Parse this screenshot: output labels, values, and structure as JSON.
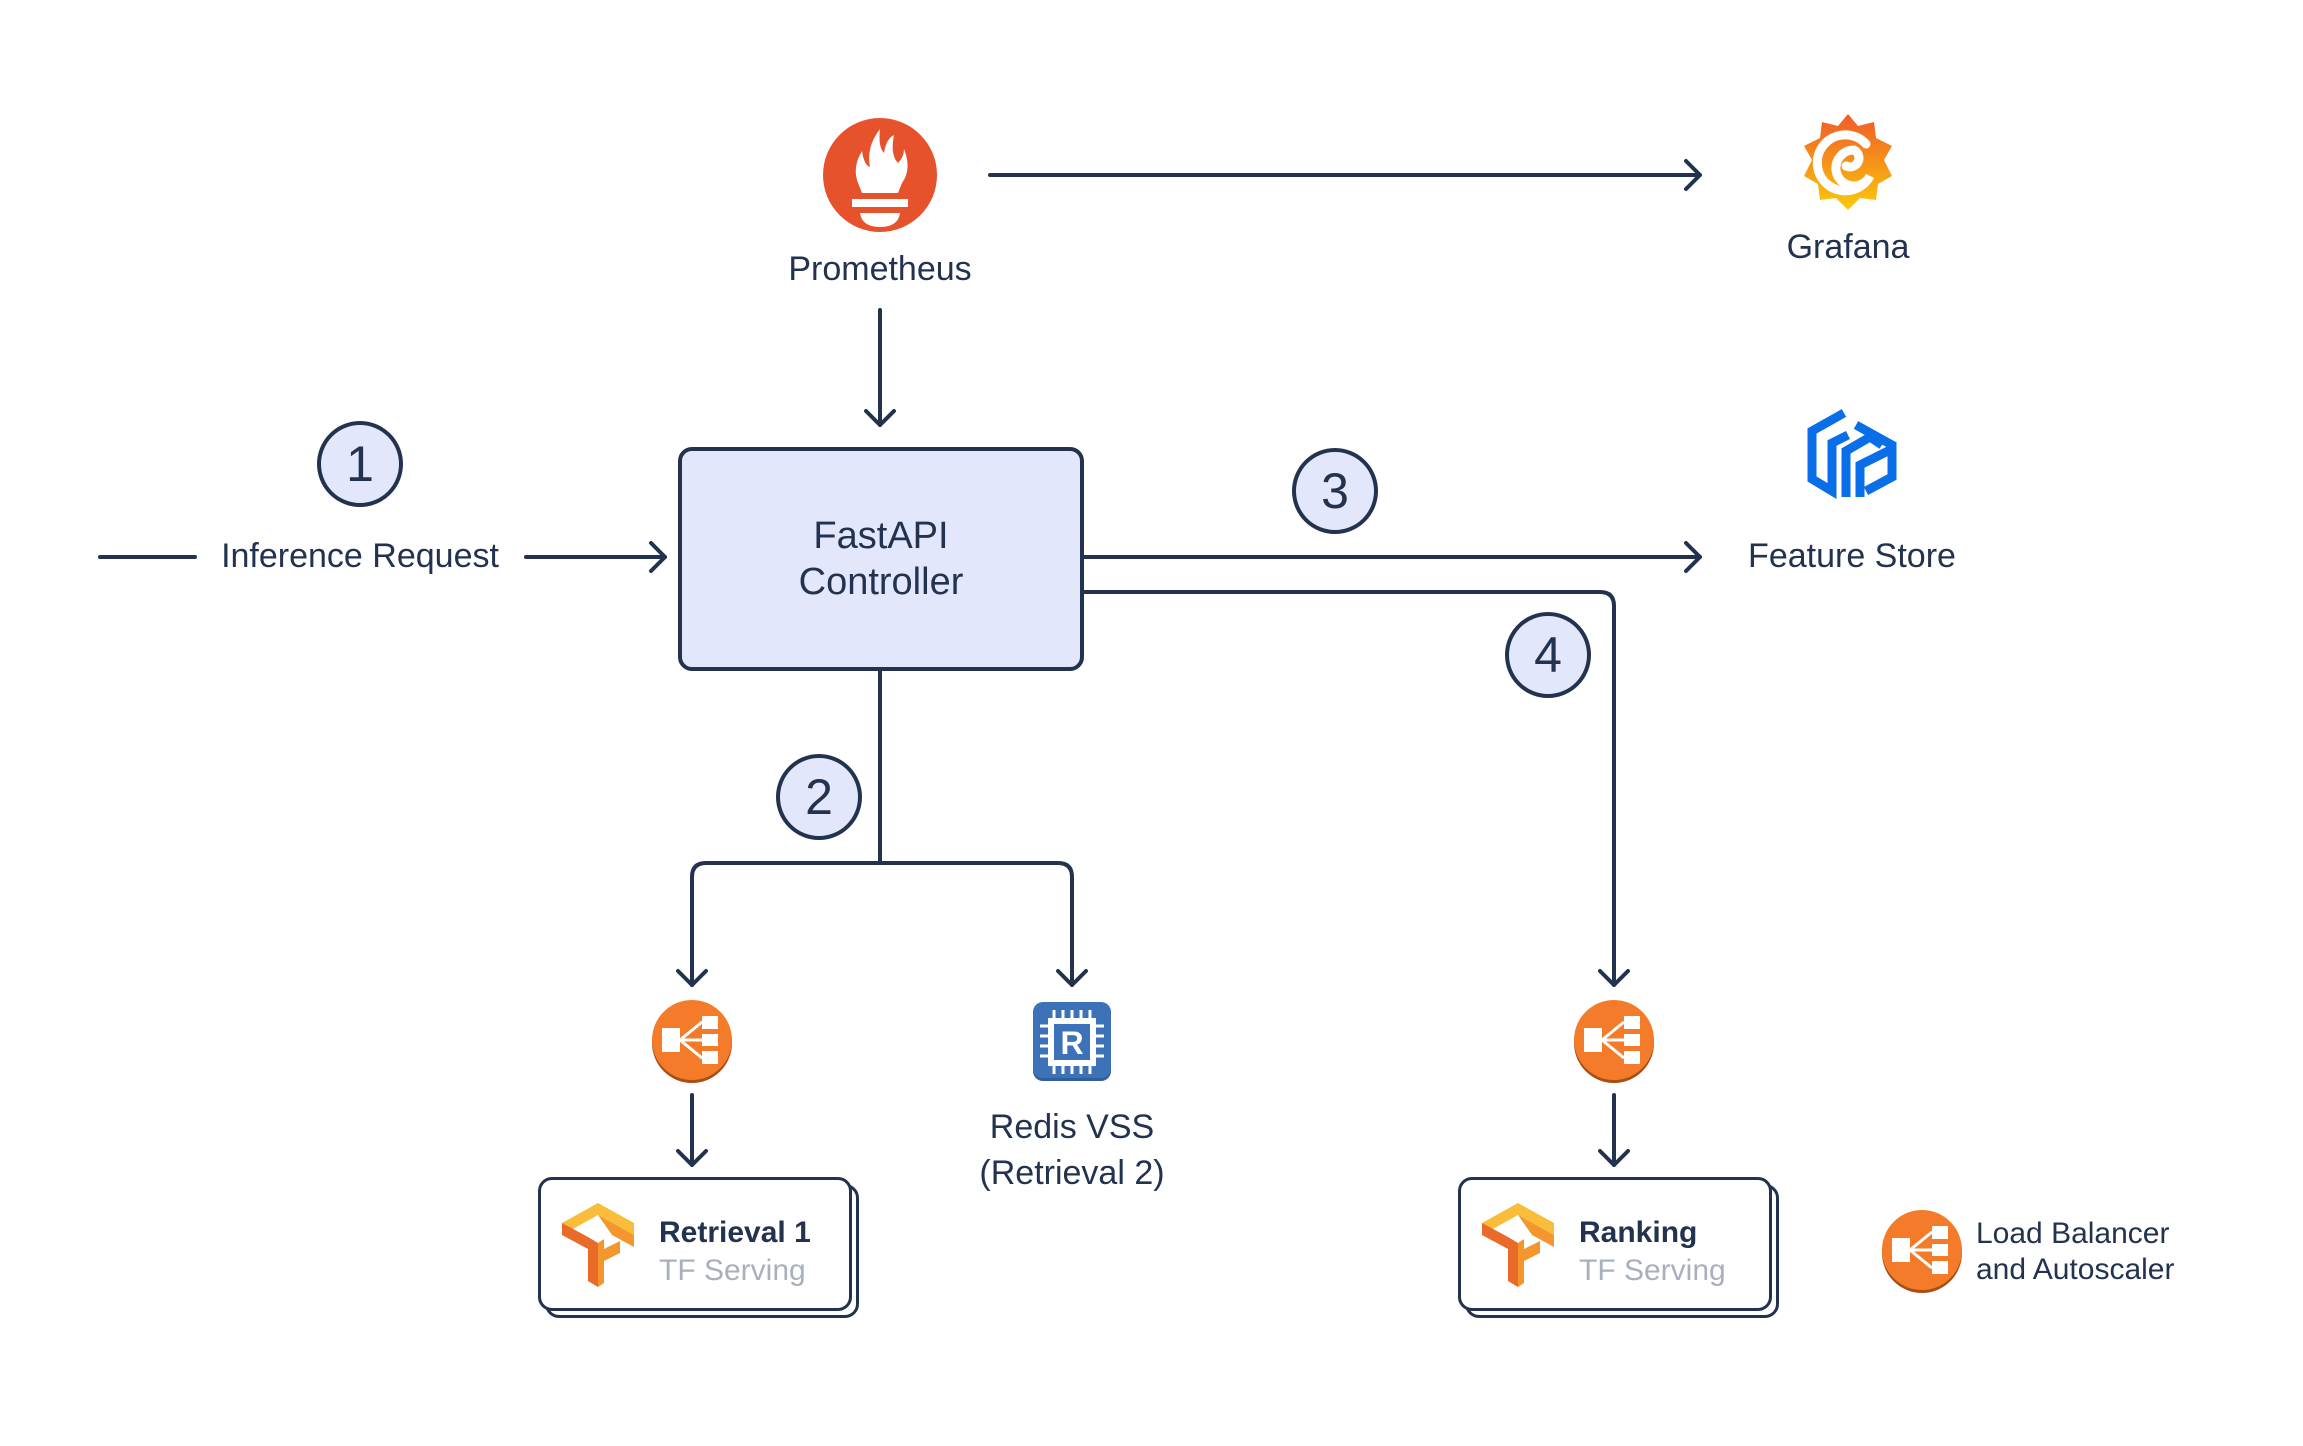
{
  "diagram": {
    "colors": {
      "line": "#22324f",
      "controller_fill": "#e2e7fb",
      "prometheus": "#e6522c",
      "grafana_top": "#f05a28",
      "grafana_bottom": "#fbca0a",
      "feature_store": "#0a6ee8",
      "load_balancer": "#f47b2a",
      "redis": "#3d72b8",
      "tf_orange": "#f08a24",
      "subtitle": "#a9b0bd"
    },
    "nodes": {
      "prometheus": {
        "label": "Prometheus",
        "icon": "prometheus-torch-icon"
      },
      "grafana": {
        "label": "Grafana",
        "icon": "grafana-swirl-icon"
      },
      "feature_store": {
        "label": "Feature Store",
        "icon": "feature-store-cube-icon"
      },
      "controller": {
        "line1": "FastAPI",
        "line2": "Controller"
      },
      "inference_request": {
        "label": "Inference Request"
      },
      "redis": {
        "line1": "Redis VSS",
        "line2": "(Retrieval 2)",
        "icon": "redis-chip-icon"
      },
      "retrieval1": {
        "title": "Retrieval 1",
        "subtitle": "TF Serving",
        "icon": "tensorflow-icon"
      },
      "ranking": {
        "title": "Ranking",
        "subtitle": "TF Serving",
        "icon": "tensorflow-icon"
      }
    },
    "steps": [
      "1",
      "2",
      "3",
      "4"
    ],
    "legend": {
      "line1": "Load Balancer",
      "line2": "and Autoscaler",
      "icon": "load-balancer-icon"
    }
  }
}
